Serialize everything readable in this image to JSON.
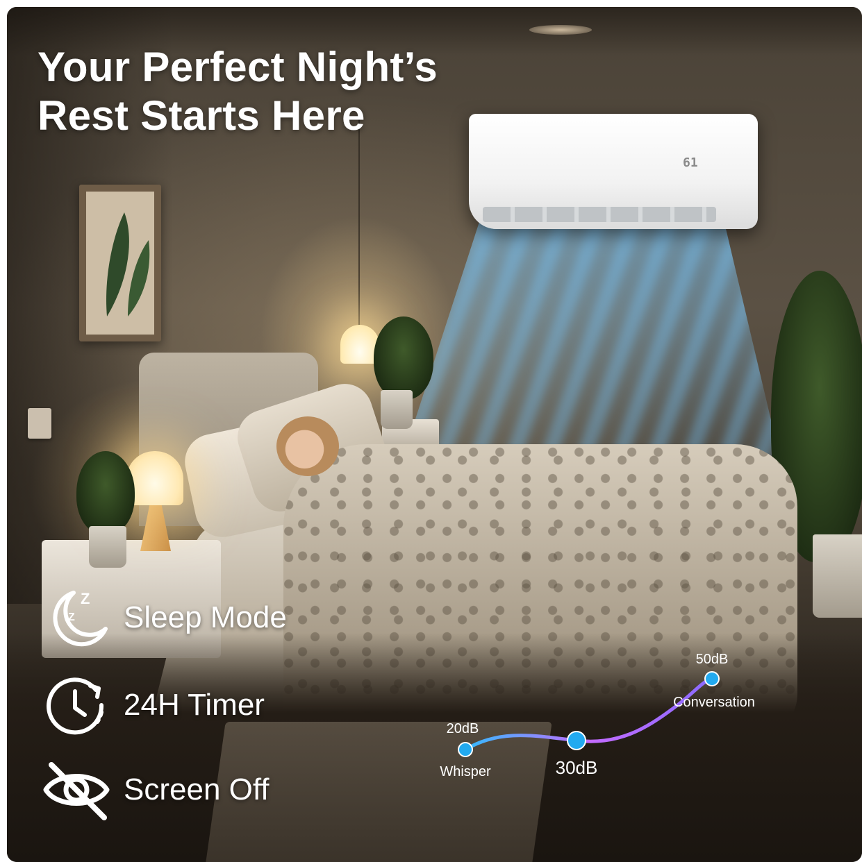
{
  "headline": {
    "line1": "Your Perfect Night’s",
    "line2": "Rest Starts Here"
  },
  "ac_display": "61",
  "features": [
    {
      "icon": "moon-sleep-icon",
      "label": "Sleep Mode"
    },
    {
      "icon": "timer-clock-icon",
      "label": "24H Timer"
    },
    {
      "icon": "eye-off-icon",
      "label": "Screen Off"
    }
  ],
  "noise_levels": [
    {
      "value": "20dB",
      "label": "Whisper"
    },
    {
      "value": "30dB",
      "label": ""
    },
    {
      "value": "50dB",
      "label": "Conversation"
    }
  ],
  "colors": {
    "text": "#ffffff",
    "airflow": "#82cdff",
    "dot": "#22aaf0",
    "curve_start": "#33bbff",
    "curve_end": "#c46bff"
  }
}
